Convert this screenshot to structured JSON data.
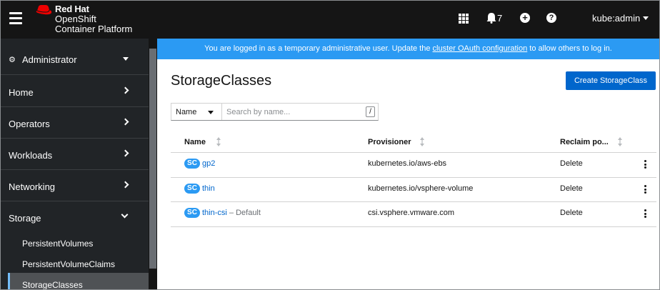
{
  "masthead": {
    "brand_line1": "Red Hat",
    "brand_line2": "OpenShift",
    "brand_line3": "Container Platform",
    "notification_count": "7",
    "plus_glyph": "+",
    "help_glyph": "?",
    "user": "kube:admin"
  },
  "sidebar": {
    "perspective": "Administrator",
    "items": [
      {
        "label": "Home"
      },
      {
        "label": "Operators"
      },
      {
        "label": "Workloads"
      },
      {
        "label": "Networking"
      },
      {
        "label": "Storage"
      }
    ],
    "storage_sub": [
      {
        "label": "PersistentVolumes"
      },
      {
        "label": "PersistentVolumeClaims"
      },
      {
        "label": "StorageClasses"
      }
    ]
  },
  "banner": {
    "prefix": "You are logged in as a temporary administrative user. Update the",
    "link": "cluster OAuth configuration",
    "suffix": "to allow others to log in."
  },
  "page": {
    "title": "StorageClasses",
    "create_button": "Create StorageClass"
  },
  "filter": {
    "select_value": "Name",
    "placeholder": "Search by name...",
    "shortcut": "/"
  },
  "table": {
    "columns": [
      "Name",
      "Provisioner",
      "Reclaim po..."
    ],
    "rows": [
      {
        "badge": "SC",
        "name": "gp2",
        "default": "",
        "provisioner": "kubernetes.io/aws-ebs",
        "reclaim": "Delete"
      },
      {
        "badge": "SC",
        "name": "thin",
        "default": "",
        "provisioner": "kubernetes.io/vsphere-volume",
        "reclaim": "Delete"
      },
      {
        "badge": "SC",
        "name": "thin-csi",
        "default": "– Default",
        "provisioner": "csi.vsphere.vmware.com",
        "reclaim": "Delete"
      }
    ]
  },
  "colors": {
    "masthead_bg": "#151515",
    "sidebar_bg": "#212427",
    "banner_bg": "#2b9af3",
    "primary": "#0066cc",
    "brand_red": "#ee0000"
  }
}
